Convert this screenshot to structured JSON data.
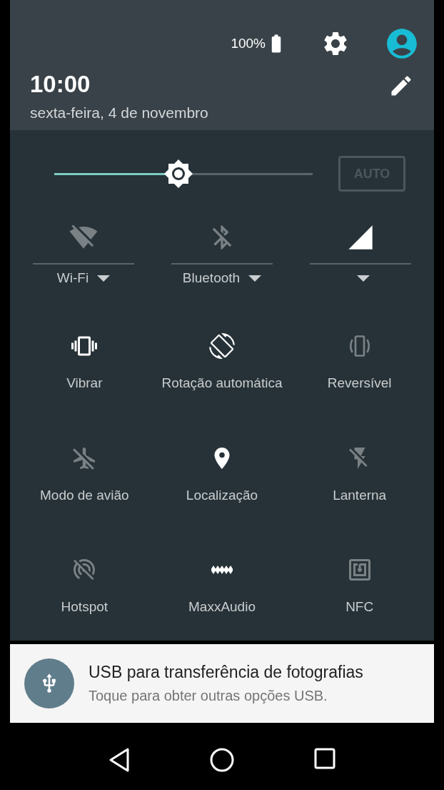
{
  "status_bar": {
    "battery": "100%"
  },
  "header": {
    "time": "10:00",
    "date": "sexta-feira, 4 de novembro"
  },
  "brightness": {
    "level": 0.48,
    "auto_label": "AUTO",
    "auto_on": false
  },
  "connectivity": [
    {
      "kind": "wifi",
      "label": "Wi-Fi",
      "on": false
    },
    {
      "kind": "bluetooth",
      "label": "Bluetooth",
      "on": false
    },
    {
      "kind": "cellular",
      "on": true
    }
  ],
  "tiles": [
    {
      "kind": "vibrate",
      "label": "Vibrar",
      "on": true
    },
    {
      "kind": "rotation",
      "label": "Rotação automática",
      "on": true
    },
    {
      "kind": "reversible",
      "label": "Reversível",
      "on": false
    },
    {
      "kind": "airplane",
      "label": "Modo de avião",
      "on": false
    },
    {
      "kind": "location",
      "label": "Localização",
      "on": true
    },
    {
      "kind": "flashlight",
      "label": "Lanterna",
      "on": false
    },
    {
      "kind": "hotspot",
      "label": "Hotspot",
      "on": false
    },
    {
      "kind": "audio",
      "label": "MaxxAudio",
      "on": true
    },
    {
      "kind": "nfc",
      "label": "NFC",
      "on": false
    }
  ],
  "notification": {
    "title": "USB para transferência de fotografias",
    "text": "Toque para obter outras opções USB."
  }
}
